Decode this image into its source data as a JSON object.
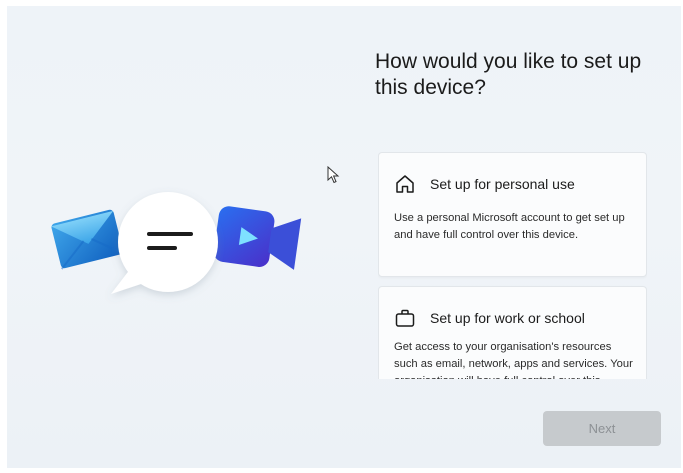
{
  "page": {
    "title": "How would you like to set up this device?"
  },
  "options": [
    {
      "title": "Set up for personal use",
      "description": "Use a personal Microsoft account to get set up and have full control over this device.",
      "icon": "home-icon"
    },
    {
      "title": "Set up for work or school",
      "description": "Get access to your organisation's resources such as email, network, apps and services. Your organisation will have full control over this device.",
      "icon": "briefcase-icon"
    }
  ],
  "footer": {
    "next_label": "Next"
  },
  "hero_icons": [
    "mail-icon",
    "chat-bubble-icon",
    "video-camera-icon"
  ],
  "colors": {
    "accent_blue": "#1f6fd6",
    "next_disabled_bg": "#c6cacd",
    "next_disabled_text": "#8d9195",
    "background": "#eef3f8"
  }
}
